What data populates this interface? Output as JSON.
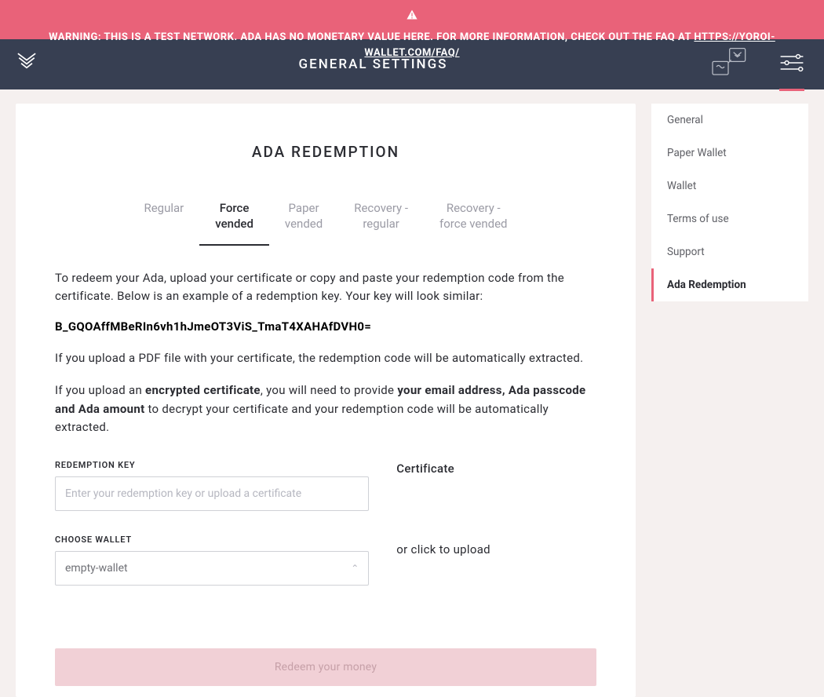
{
  "warning": {
    "text": "WARNING: THIS IS A TEST NETWORK. ADA HAS NO MONETARY VALUE HERE. FOR MORE INFORMATION, CHECK OUT THE FAQ AT",
    "link_text": "HTTPS://YOROI-WALLET.COM/FAQ/"
  },
  "header": {
    "title": "GENERAL SETTINGS"
  },
  "sidebar": {
    "items": [
      {
        "label": "General",
        "active": false
      },
      {
        "label": "Paper Wallet",
        "active": false
      },
      {
        "label": "Wallet",
        "active": false
      },
      {
        "label": "Terms of use",
        "active": false
      },
      {
        "label": "Support",
        "active": false
      },
      {
        "label": "Ada Redemption",
        "active": true
      }
    ]
  },
  "page": {
    "heading": "ADA REDEMPTION",
    "tabs": [
      {
        "label": "Regular",
        "active": false
      },
      {
        "label": "Force\nvended",
        "active": true
      },
      {
        "label": "Paper\nvended",
        "active": false
      },
      {
        "label": "Recovery -\nregular",
        "active": false
      },
      {
        "label": "Recovery -\nforce vended",
        "active": false
      }
    ],
    "intro_text": "To redeem your Ada, upload your certificate or copy and paste your redemption code from the certificate. Below is an example of a redemption key. Your key will look similar:",
    "key_example": "B_GQOAffMBeRIn6vh1hJmeOT3ViS_TmaT4XAHAfDVH0=",
    "pdf_text": "If you upload a PDF file with your certificate, the redemption code will be automatically extracted.",
    "encrypted_prefix": "If you upload an ",
    "encrypted_bold1": "encrypted certificate",
    "encrypted_mid": ", you will need to provide ",
    "encrypted_bold2": "your email address, Ada passcode and Ada amount",
    "encrypted_suffix": " to decrypt your certificate and your redemption code will be automatically extracted.",
    "redemption_key_label": "REDEMPTION KEY",
    "redemption_key_placeholder": "Enter your redemption key or upload a certificate",
    "choose_wallet_label": "CHOOSE WALLET",
    "choose_wallet_value": "empty-wallet",
    "certificate_heading": "Certificate",
    "upload_hint": "or click to upload",
    "redeem_button": "Redeem your money"
  },
  "colors": {
    "accent": "#E96279",
    "header_bg": "#373f52",
    "body_bg": "#f5f0ef"
  }
}
